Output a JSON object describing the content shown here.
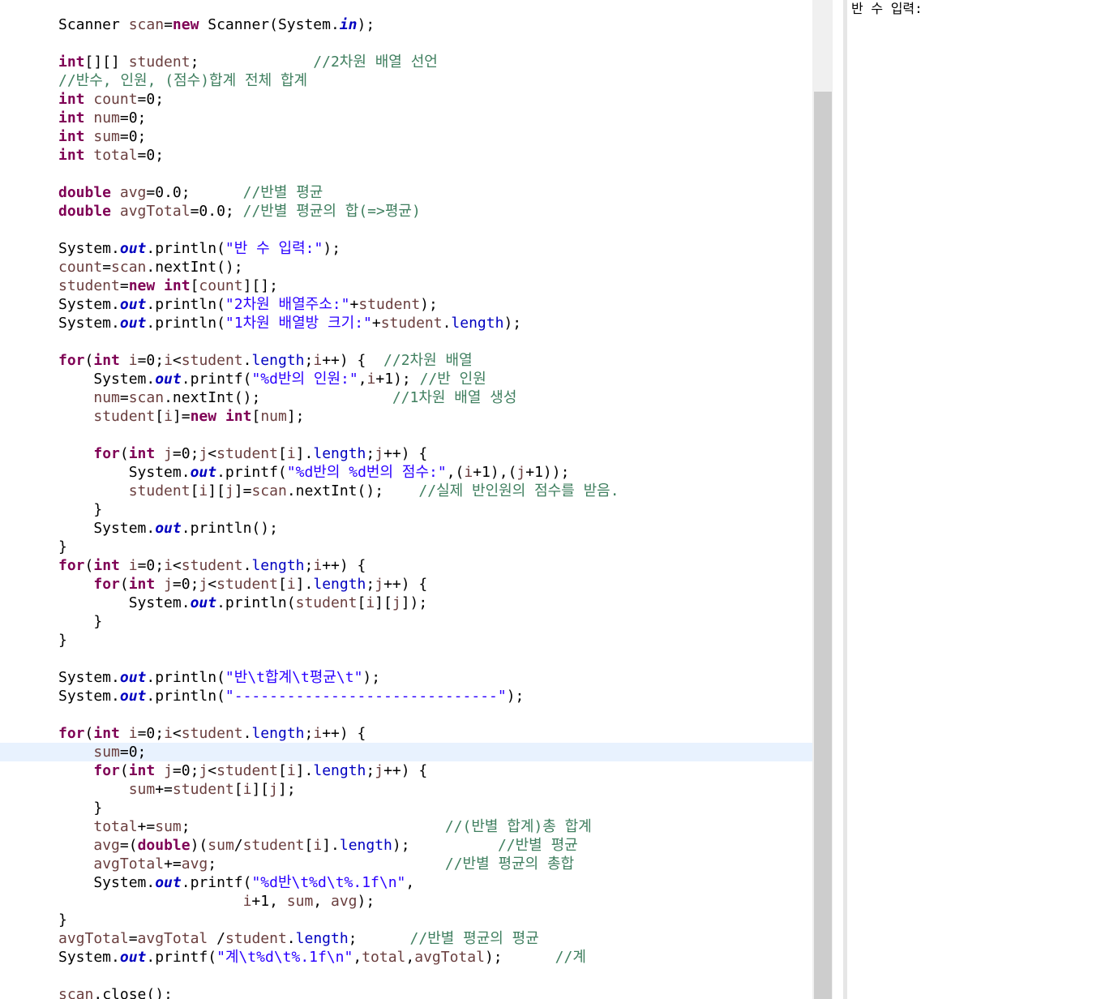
{
  "editor": {
    "highlighted_line": 39,
    "lines": [
      [
        [
          "plain",
          "Scanner "
        ],
        [
          "var",
          "scan"
        ],
        [
          "plain",
          "="
        ],
        [
          "kw",
          "new"
        ],
        [
          "plain",
          " Scanner(System."
        ],
        [
          "sfld",
          "in"
        ],
        [
          "plain",
          ");"
        ]
      ],
      [],
      [
        [
          "kw",
          "int"
        ],
        [
          "plain",
          "[][] "
        ],
        [
          "var",
          "student"
        ],
        [
          "plain",
          ";             "
        ],
        [
          "com",
          "//2차원 배열 선언"
        ]
      ],
      [
        [
          "com",
          "//반수, 인원, (점수)합계 전체 합계"
        ]
      ],
      [
        [
          "kw",
          "int"
        ],
        [
          "plain",
          " "
        ],
        [
          "var",
          "count"
        ],
        [
          "plain",
          "=0;"
        ]
      ],
      [
        [
          "kw",
          "int"
        ],
        [
          "plain",
          " "
        ],
        [
          "var",
          "num"
        ],
        [
          "plain",
          "=0;"
        ]
      ],
      [
        [
          "kw",
          "int"
        ],
        [
          "plain",
          " "
        ],
        [
          "var",
          "sum"
        ],
        [
          "plain",
          "=0;"
        ]
      ],
      [
        [
          "kw",
          "int"
        ],
        [
          "plain",
          " "
        ],
        [
          "var",
          "total"
        ],
        [
          "plain",
          "=0;"
        ]
      ],
      [],
      [
        [
          "kw",
          "double"
        ],
        [
          "plain",
          " "
        ],
        [
          "var",
          "avg"
        ],
        [
          "plain",
          "=0.0;      "
        ],
        [
          "com",
          "//반별 평균"
        ]
      ],
      [
        [
          "kw",
          "double"
        ],
        [
          "plain",
          " "
        ],
        [
          "var",
          "avgTotal"
        ],
        [
          "plain",
          "=0.0; "
        ],
        [
          "com",
          "//반별 평균의 합(=>평균)"
        ]
      ],
      [],
      [
        [
          "plain",
          "System."
        ],
        [
          "sfld",
          "out"
        ],
        [
          "plain",
          ".println("
        ],
        [
          "str",
          "\"반 수 입력:\""
        ],
        [
          "plain",
          ");"
        ]
      ],
      [
        [
          "var",
          "count"
        ],
        [
          "plain",
          "="
        ],
        [
          "var",
          "scan"
        ],
        [
          "plain",
          ".nextInt();"
        ]
      ],
      [
        [
          "var",
          "student"
        ],
        [
          "plain",
          "="
        ],
        [
          "kw",
          "new"
        ],
        [
          "plain",
          " "
        ],
        [
          "kw",
          "int"
        ],
        [
          "plain",
          "["
        ],
        [
          "var",
          "count"
        ],
        [
          "plain",
          "][];"
        ]
      ],
      [
        [
          "plain",
          "System."
        ],
        [
          "sfld",
          "out"
        ],
        [
          "plain",
          ".println("
        ],
        [
          "str",
          "\"2차원 배열주소:\""
        ],
        [
          "plain",
          "+"
        ],
        [
          "var",
          "student"
        ],
        [
          "plain",
          ");"
        ]
      ],
      [
        [
          "plain",
          "System."
        ],
        [
          "sfld",
          "out"
        ],
        [
          "plain",
          ".println("
        ],
        [
          "str",
          "\"1차원 배열방 크기:\""
        ],
        [
          "plain",
          "+"
        ],
        [
          "var",
          "student"
        ],
        [
          "plain",
          "."
        ],
        [
          "fld",
          "length"
        ],
        [
          "plain",
          ");"
        ]
      ],
      [],
      [
        [
          "kw",
          "for"
        ],
        [
          "plain",
          "("
        ],
        [
          "kw",
          "int"
        ],
        [
          "plain",
          " "
        ],
        [
          "var",
          "i"
        ],
        [
          "plain",
          "=0;"
        ],
        [
          "var",
          "i"
        ],
        [
          "plain",
          "<"
        ],
        [
          "var",
          "student"
        ],
        [
          "plain",
          "."
        ],
        [
          "fld",
          "length"
        ],
        [
          "plain",
          ";"
        ],
        [
          "var",
          "i"
        ],
        [
          "plain",
          "++) {  "
        ],
        [
          "com",
          "//2차원 배열"
        ]
      ],
      [
        [
          "plain",
          "    System."
        ],
        [
          "sfld",
          "out"
        ],
        [
          "plain",
          ".printf("
        ],
        [
          "str",
          "\"%d반의 인원:\""
        ],
        [
          "plain",
          ","
        ],
        [
          "var",
          "i"
        ],
        [
          "plain",
          "+1); "
        ],
        [
          "com",
          "//반 인원"
        ]
      ],
      [
        [
          "plain",
          "    "
        ],
        [
          "var",
          "num"
        ],
        [
          "plain",
          "="
        ],
        [
          "var",
          "scan"
        ],
        [
          "plain",
          ".nextInt();               "
        ],
        [
          "com",
          "//1차원 배열 생성"
        ]
      ],
      [
        [
          "plain",
          "    "
        ],
        [
          "var",
          "student"
        ],
        [
          "plain",
          "["
        ],
        [
          "var",
          "i"
        ],
        [
          "plain",
          "]="
        ],
        [
          "kw",
          "new"
        ],
        [
          "plain",
          " "
        ],
        [
          "kw",
          "int"
        ],
        [
          "plain",
          "["
        ],
        [
          "var",
          "num"
        ],
        [
          "plain",
          "];"
        ]
      ],
      [],
      [
        [
          "plain",
          "    "
        ],
        [
          "kw",
          "for"
        ],
        [
          "plain",
          "("
        ],
        [
          "kw",
          "int"
        ],
        [
          "plain",
          " "
        ],
        [
          "var",
          "j"
        ],
        [
          "plain",
          "=0;"
        ],
        [
          "var",
          "j"
        ],
        [
          "plain",
          "<"
        ],
        [
          "var",
          "student"
        ],
        [
          "plain",
          "["
        ],
        [
          "var",
          "i"
        ],
        [
          "plain",
          "]."
        ],
        [
          "fld",
          "length"
        ],
        [
          "plain",
          ";"
        ],
        [
          "var",
          "j"
        ],
        [
          "plain",
          "++) {"
        ]
      ],
      [
        [
          "plain",
          "        System."
        ],
        [
          "sfld",
          "out"
        ],
        [
          "plain",
          ".printf("
        ],
        [
          "str",
          "\"%d반의 %d번의 점수:\""
        ],
        [
          "plain",
          ",("
        ],
        [
          "var",
          "i"
        ],
        [
          "plain",
          "+1),("
        ],
        [
          "var",
          "j"
        ],
        [
          "plain",
          "+1));"
        ]
      ],
      [
        [
          "plain",
          "        "
        ],
        [
          "var",
          "student"
        ],
        [
          "plain",
          "["
        ],
        [
          "var",
          "i"
        ],
        [
          "plain",
          "]["
        ],
        [
          "var",
          "j"
        ],
        [
          "plain",
          "]="
        ],
        [
          "var",
          "scan"
        ],
        [
          "plain",
          ".nextInt();    "
        ],
        [
          "com",
          "//실제 반인원의 점수를 받음."
        ]
      ],
      [
        [
          "plain",
          "    }"
        ]
      ],
      [
        [
          "plain",
          "    System."
        ],
        [
          "sfld",
          "out"
        ],
        [
          "plain",
          ".println();"
        ]
      ],
      [
        [
          "plain",
          "}"
        ]
      ],
      [
        [
          "kw",
          "for"
        ],
        [
          "plain",
          "("
        ],
        [
          "kw",
          "int"
        ],
        [
          "plain",
          " "
        ],
        [
          "var",
          "i"
        ],
        [
          "plain",
          "=0;"
        ],
        [
          "var",
          "i"
        ],
        [
          "plain",
          "<"
        ],
        [
          "var",
          "student"
        ],
        [
          "plain",
          "."
        ],
        [
          "fld",
          "length"
        ],
        [
          "plain",
          ";"
        ],
        [
          "var",
          "i"
        ],
        [
          "plain",
          "++) {"
        ]
      ],
      [
        [
          "plain",
          "    "
        ],
        [
          "kw",
          "for"
        ],
        [
          "plain",
          "("
        ],
        [
          "kw",
          "int"
        ],
        [
          "plain",
          " "
        ],
        [
          "var",
          "j"
        ],
        [
          "plain",
          "=0;"
        ],
        [
          "var",
          "j"
        ],
        [
          "plain",
          "<"
        ],
        [
          "var",
          "student"
        ],
        [
          "plain",
          "["
        ],
        [
          "var",
          "i"
        ],
        [
          "plain",
          "]."
        ],
        [
          "fld",
          "length"
        ],
        [
          "plain",
          ";"
        ],
        [
          "var",
          "j"
        ],
        [
          "plain",
          "++) {"
        ]
      ],
      [
        [
          "plain",
          "        System."
        ],
        [
          "sfld",
          "out"
        ],
        [
          "plain",
          ".println("
        ],
        [
          "var",
          "student"
        ],
        [
          "plain",
          "["
        ],
        [
          "var",
          "i"
        ],
        [
          "plain",
          "]["
        ],
        [
          "var",
          "j"
        ],
        [
          "plain",
          "]);"
        ]
      ],
      [
        [
          "plain",
          "    }"
        ]
      ],
      [
        [
          "plain",
          "}"
        ]
      ],
      [],
      [
        [
          "plain",
          "System."
        ],
        [
          "sfld",
          "out"
        ],
        [
          "plain",
          ".println("
        ],
        [
          "str",
          "\"반\\t합계\\t평균\\t\""
        ],
        [
          "plain",
          ");"
        ]
      ],
      [
        [
          "plain",
          "System."
        ],
        [
          "sfld",
          "out"
        ],
        [
          "plain",
          ".println("
        ],
        [
          "str",
          "\"------------------------------\""
        ],
        [
          "plain",
          ");"
        ]
      ],
      [],
      [
        [
          "kw",
          "for"
        ],
        [
          "plain",
          "("
        ],
        [
          "kw",
          "int"
        ],
        [
          "plain",
          " "
        ],
        [
          "var",
          "i"
        ],
        [
          "plain",
          "=0;"
        ],
        [
          "var",
          "i"
        ],
        [
          "plain",
          "<"
        ],
        [
          "var",
          "student"
        ],
        [
          "plain",
          "."
        ],
        [
          "fld",
          "length"
        ],
        [
          "plain",
          ";"
        ],
        [
          "var",
          "i"
        ],
        [
          "plain",
          "++) {"
        ]
      ],
      [
        [
          "plain",
          "    "
        ],
        [
          "var",
          "sum"
        ],
        [
          "plain",
          "=0;"
        ]
      ],
      [
        [
          "plain",
          "    "
        ],
        [
          "kw",
          "for"
        ],
        [
          "plain",
          "("
        ],
        [
          "kw",
          "int"
        ],
        [
          "plain",
          " "
        ],
        [
          "var",
          "j"
        ],
        [
          "plain",
          "=0;"
        ],
        [
          "var",
          "j"
        ],
        [
          "plain",
          "<"
        ],
        [
          "var",
          "student"
        ],
        [
          "plain",
          "["
        ],
        [
          "var",
          "i"
        ],
        [
          "plain",
          "]."
        ],
        [
          "fld",
          "length"
        ],
        [
          "plain",
          ";"
        ],
        [
          "var",
          "j"
        ],
        [
          "plain",
          "++) {"
        ]
      ],
      [
        [
          "plain",
          "        "
        ],
        [
          "var",
          "sum"
        ],
        [
          "plain",
          "+="
        ],
        [
          "var",
          "student"
        ],
        [
          "plain",
          "["
        ],
        [
          "var",
          "i"
        ],
        [
          "plain",
          "]["
        ],
        [
          "var",
          "j"
        ],
        [
          "plain",
          "];"
        ]
      ],
      [
        [
          "plain",
          "    }"
        ]
      ],
      [
        [
          "plain",
          "    "
        ],
        [
          "var",
          "total"
        ],
        [
          "plain",
          "+="
        ],
        [
          "var",
          "sum"
        ],
        [
          "plain",
          ";                             "
        ],
        [
          "com",
          "//(반별 합계)총 합계"
        ]
      ],
      [
        [
          "plain",
          "    "
        ],
        [
          "var",
          "avg"
        ],
        [
          "plain",
          "=("
        ],
        [
          "kw",
          "double"
        ],
        [
          "plain",
          ")("
        ],
        [
          "var",
          "sum"
        ],
        [
          "plain",
          "/"
        ],
        [
          "var",
          "student"
        ],
        [
          "plain",
          "["
        ],
        [
          "var",
          "i"
        ],
        [
          "plain",
          "]."
        ],
        [
          "fld",
          "length"
        ],
        [
          "plain",
          ");          "
        ],
        [
          "com",
          "//반별 평균"
        ]
      ],
      [
        [
          "plain",
          "    "
        ],
        [
          "var",
          "avgTotal"
        ],
        [
          "plain",
          "+="
        ],
        [
          "var",
          "avg"
        ],
        [
          "plain",
          ";                          "
        ],
        [
          "com",
          "//반별 평균의 총합"
        ]
      ],
      [
        [
          "plain",
          "    System."
        ],
        [
          "sfld",
          "out"
        ],
        [
          "plain",
          ".printf("
        ],
        [
          "str",
          "\"%d반\\t%d\\t%.1f\\n\""
        ],
        [
          "plain",
          ","
        ]
      ],
      [
        [
          "plain",
          "                     "
        ],
        [
          "var",
          "i"
        ],
        [
          "plain",
          "+1, "
        ],
        [
          "var",
          "sum"
        ],
        [
          "plain",
          ", "
        ],
        [
          "var",
          "avg"
        ],
        [
          "plain",
          ");"
        ]
      ],
      [
        [
          "plain",
          "}"
        ]
      ],
      [
        [
          "var",
          "avgTotal"
        ],
        [
          "plain",
          "="
        ],
        [
          "var",
          "avgTotal"
        ],
        [
          "plain",
          " /"
        ],
        [
          "var",
          "student"
        ],
        [
          "plain",
          "."
        ],
        [
          "fld",
          "length"
        ],
        [
          "plain",
          ";      "
        ],
        [
          "com",
          "//반별 평균의 평균"
        ]
      ],
      [
        [
          "plain",
          "System."
        ],
        [
          "sfld",
          "out"
        ],
        [
          "plain",
          ".printf("
        ],
        [
          "str",
          "\"계\\t%d\\t%.1f\\n\""
        ],
        [
          "plain",
          ","
        ],
        [
          "var",
          "total"
        ],
        [
          "plain",
          ","
        ],
        [
          "var",
          "avgTotal"
        ],
        [
          "plain",
          ");      "
        ],
        [
          "com",
          "//계"
        ]
      ],
      [],
      [
        [
          "var",
          "scan"
        ],
        [
          "plain",
          ".close();"
        ]
      ]
    ]
  },
  "console": {
    "output": "반 수 입력:"
  },
  "colors": {
    "keyword": "#7f0055",
    "local_variable": "#6a3e3e",
    "field": "#0000c0",
    "string": "#2a00ff",
    "comment": "#3f7f5f",
    "current_line_highlight": "#e8f2fe",
    "scrollbar_thumb": "#cdcdcd"
  }
}
